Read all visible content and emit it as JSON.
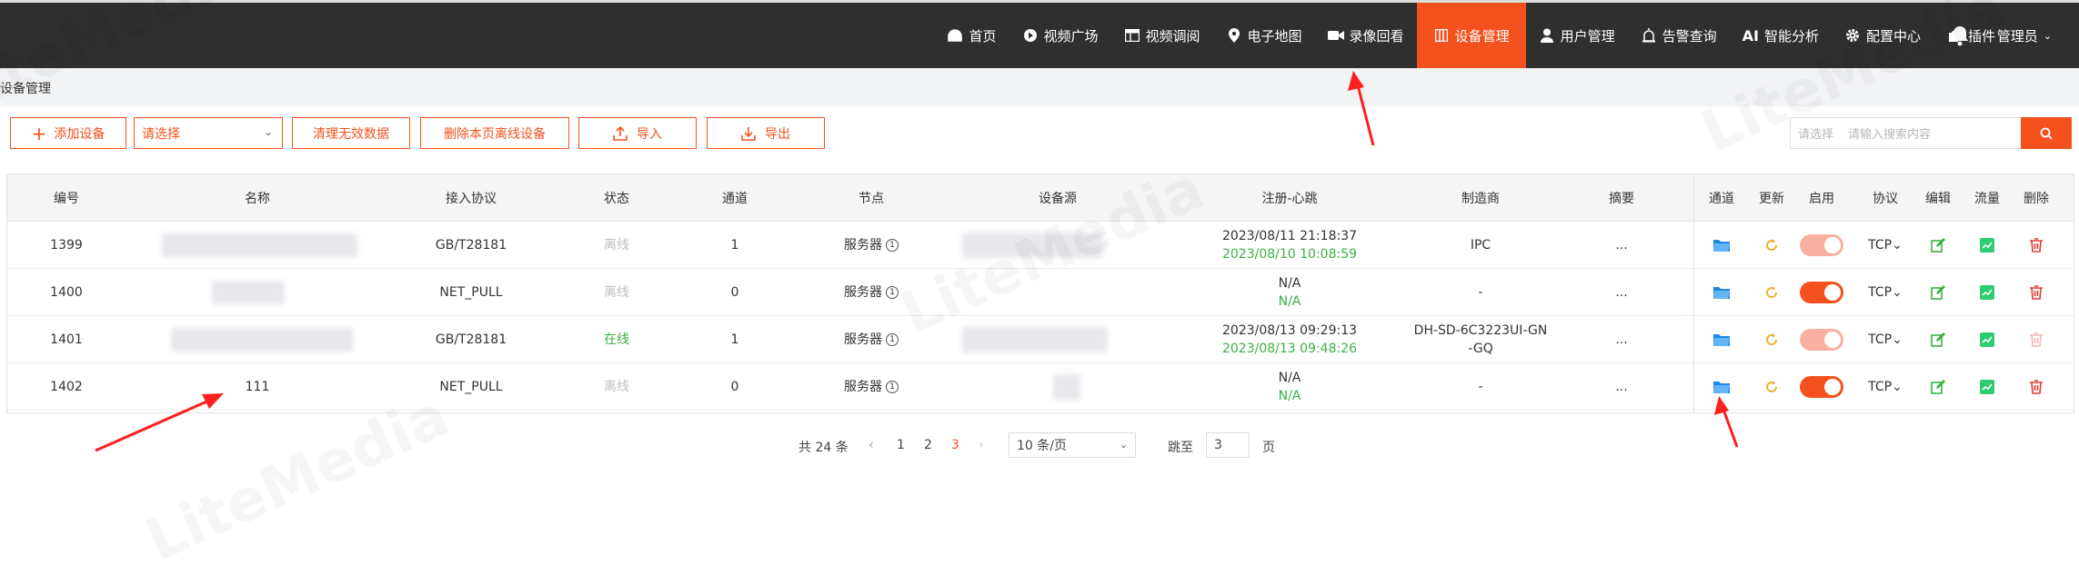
{
  "colors": {
    "accent": "#f4511e",
    "nav_bg": "#2f2f2f",
    "online": "#3cb043",
    "folder": "#1e88e5",
    "refresh": "#f5a623",
    "chart": "#2ecc71"
  },
  "nav": {
    "items": [
      {
        "label": "首页",
        "icon": "dashboard-icon"
      },
      {
        "label": "视频广场",
        "icon": "play-icon"
      },
      {
        "label": "视频调阅",
        "icon": "grid-icon"
      },
      {
        "label": "电子地图",
        "icon": "map-pin-icon"
      },
      {
        "label": "录像回看",
        "icon": "video-camera-icon"
      },
      {
        "label": "设备管理",
        "icon": "device-icon"
      },
      {
        "label": "用户管理",
        "icon": "user-icon"
      },
      {
        "label": "告警查询",
        "icon": "alarm-icon"
      },
      {
        "label": "智能分析",
        "icon": "ai-icon",
        "prefix": "AI"
      },
      {
        "label": "配置中心",
        "icon": "gear-icon"
      },
      {
        "label": "插件",
        "icon": "puzzle-icon"
      }
    ],
    "user": "管理员"
  },
  "breadcrumb": "设备管理",
  "toolbar": {
    "add": "添加设备",
    "select_placeholder": "请选择",
    "clean": "清理无效数据",
    "delete_offline": "删除本页离线设备",
    "import": "导入",
    "export": "导出",
    "search_select": "请选择",
    "search_placeholder": "请输入搜索内容"
  },
  "table": {
    "headers": {
      "id": "编号",
      "name": "名称",
      "protocol": "接入协议",
      "status": "状态",
      "channels": "通道",
      "node": "节点",
      "source": "设备源",
      "register": "注册-心跳",
      "maker": "制造商",
      "summary": "摘要",
      "channel_op": "通道",
      "update": "更新",
      "enable": "启用",
      "proto_op": "协议",
      "edit": "编辑",
      "traffic": "流量",
      "delete": "删除"
    },
    "rows": [
      {
        "id": "1399",
        "name": "",
        "protocol": "GB/T28181",
        "status": "离线",
        "channels": "1",
        "node": "服务器",
        "reg": "2023/08/11 21:18:37",
        "beat": "2023/08/10 10:08:59",
        "maker": "IPC",
        "summary": "...",
        "enabled": "dim",
        "proto": "TCP",
        "delete_enabled": true
      },
      {
        "id": "1400",
        "name": "",
        "protocol": "NET_PULL",
        "status": "离线",
        "channels": "0",
        "node": "服务器",
        "reg": "N/A",
        "beat": "N/A",
        "maker": "-",
        "summary": "...",
        "enabled": "on",
        "proto": "TCP",
        "delete_enabled": true
      },
      {
        "id": "1401",
        "name": "",
        "protocol": "GB/T28181",
        "status": "在线",
        "channels": "1",
        "node": "服务器",
        "reg": "2023/08/13 09:29:13",
        "beat": "2023/08/13 09:48:26",
        "maker": "DH-SD-6C3223UI-GN\n-GQ",
        "summary": "...",
        "enabled": "dim",
        "proto": "TCP",
        "delete_enabled": false
      },
      {
        "id": "1402",
        "name": "111",
        "protocol": "NET_PULL",
        "status": "离线",
        "channels": "0",
        "node": "服务器",
        "reg": "N/A",
        "beat": "N/A",
        "maker": "-",
        "summary": "...",
        "enabled": "on",
        "proto": "TCP",
        "delete_enabled": true
      }
    ]
  },
  "pager": {
    "total": "共 24 条",
    "prev": "‹",
    "pages": [
      "1",
      "2",
      "3"
    ],
    "current": "3",
    "next": "›",
    "page_size": "10 条/页",
    "jump_label": "跳至",
    "jump_value": "3",
    "page_suffix": "页"
  },
  "watermark": "LiteMedia"
}
